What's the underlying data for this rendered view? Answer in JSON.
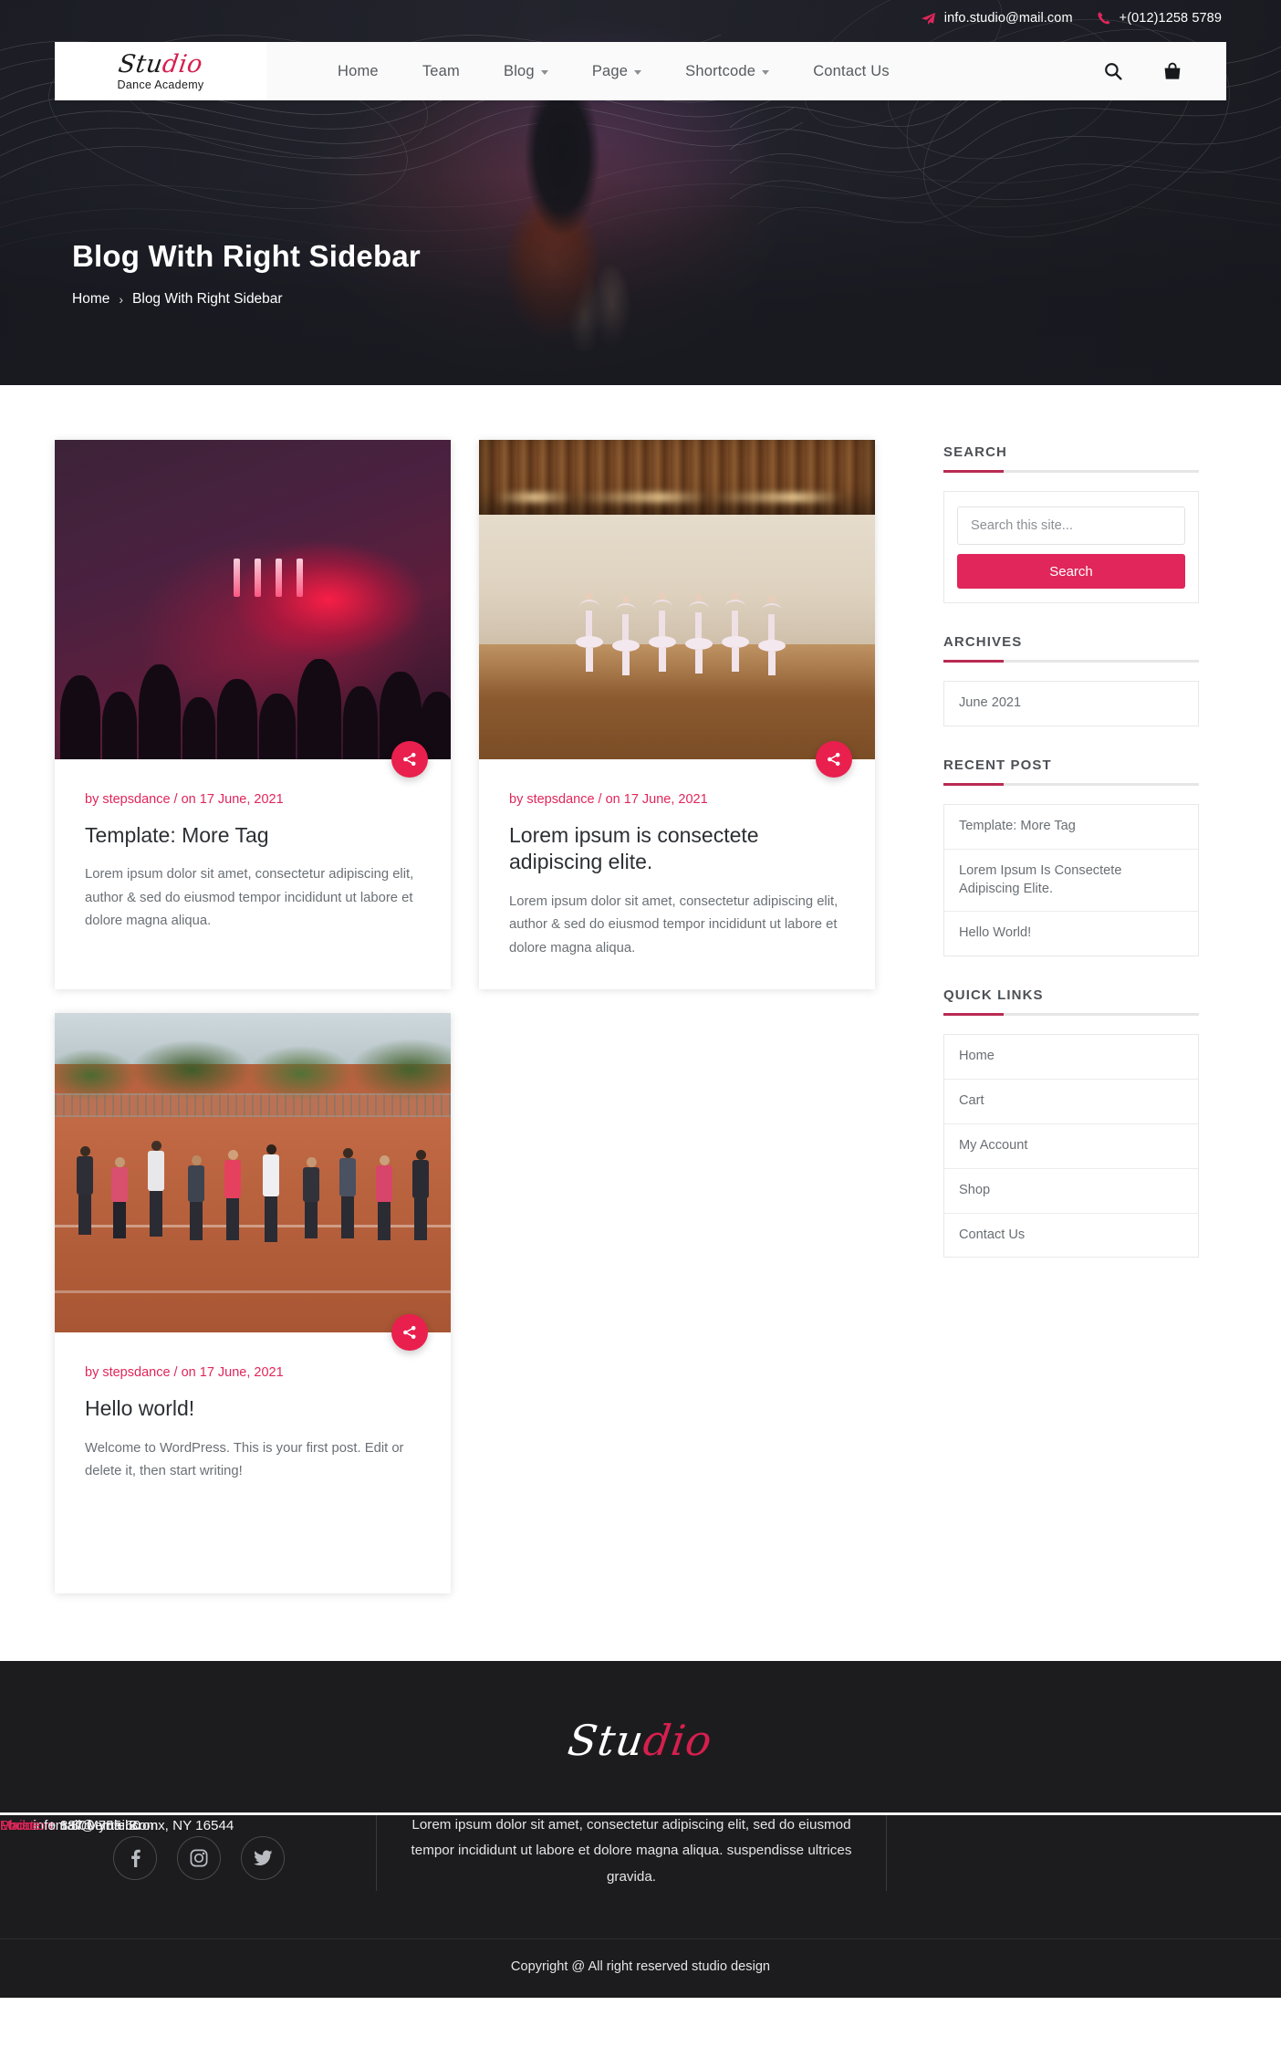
{
  "topbar": {
    "email": "info.studio@mail.com",
    "phone": "+(012)1258 5789",
    "email_icon": "paper-plane-icon",
    "phone_icon": "phone-icon"
  },
  "brand": {
    "script_part1": "Stu",
    "script_part2": "dio",
    "subtitle": "Dance Academy"
  },
  "nav": {
    "items": [
      {
        "label": "Home",
        "has_dropdown": false
      },
      {
        "label": "Team",
        "has_dropdown": false
      },
      {
        "label": "Blog",
        "has_dropdown": true
      },
      {
        "label": "Page",
        "has_dropdown": true
      },
      {
        "label": "Shortcode",
        "has_dropdown": true
      },
      {
        "label": "Contact Us",
        "has_dropdown": false
      }
    ],
    "search_icon": "search-icon",
    "cart_icon": "shopping-bag-icon"
  },
  "hero": {
    "title": "Blog With Right Sidebar",
    "breadcrumb_home": "Home",
    "breadcrumb_sep": "›",
    "breadcrumb_current": "Blog With Right Sidebar"
  },
  "posts": [
    {
      "image": "concert-crowd-red-lights",
      "meta": "by stepsdance / on 17 June, 2021",
      "title": "Template: More Tag",
      "excerpt": "Lorem ipsum dolor sit amet, consectetur adipiscing elit, author & sed do eiusmod tempor incididunt ut labore et dolore magna aliqua.",
      "share_icon": "share-icon"
    },
    {
      "image": "ballet-studio-dancers",
      "meta": "by stepsdance / on 17 June, 2021",
      "title": "Lorem ipsum is consectete adipiscing elite.",
      "excerpt": "Lorem ipsum dolor sit amet, consectetur adipiscing elit, author & sed do eiusmod tempor incididunt ut labore et dolore magna aliqua.",
      "share_icon": "share-icon"
    },
    {
      "image": "outdoor-fitness-group",
      "meta": "by stepsdance / on 17 June, 2021",
      "title": "Hello world!",
      "excerpt": "Welcome to WordPress. This is your first post. Edit or delete it, then start writing!",
      "share_icon": "share-icon"
    }
  ],
  "sidebar": {
    "search": {
      "title": "SEARCH",
      "placeholder": "Search this site...",
      "value": "",
      "button_label": "Search"
    },
    "archives": {
      "title": "ARCHIVES",
      "items": [
        "June 2021"
      ]
    },
    "recent_post": {
      "title": "RECENT POST",
      "items": [
        "Template: More Tag",
        "Lorem Ipsum Is Consectete Adipiscing Elite.",
        "Hello World!"
      ]
    },
    "quick_links": {
      "title": "QUICK LINKS",
      "items": [
        "Home",
        "Cart",
        "My Account",
        "Shop",
        "Contact Us"
      ]
    }
  },
  "footer": {
    "logo_part1": "Stu",
    "logo_part2": "dio",
    "social": [
      {
        "name": "facebook-icon",
        "label": "Facebook"
      },
      {
        "name": "instagram-icon",
        "label": "Instagram"
      },
      {
        "name": "twitter-icon",
        "label": "Twitter"
      }
    ],
    "about": "Lorem ipsum dolor sit amet, consectetur adipiscing elit, sed do eiusmod tempor incididunt ut labore et dolore magna aliqua. suspendisse ultrices gravida.",
    "contact": {
      "location_label": "Location:",
      "location_value": " 887 Myrtle.Bronx, NY 16544",
      "mail_label": "Mail:",
      "mail_value": " infomail@email.com",
      "phone_label": "Phone:",
      "phone_value": " + 1 800 755 60"
    },
    "copyright": "Copyright @ All right reserved studio design"
  },
  "colors": {
    "accent": "#e0265a",
    "accent_dark": "#b92b53",
    "dark": "#1c1c1e",
    "text": "#6a7075"
  }
}
